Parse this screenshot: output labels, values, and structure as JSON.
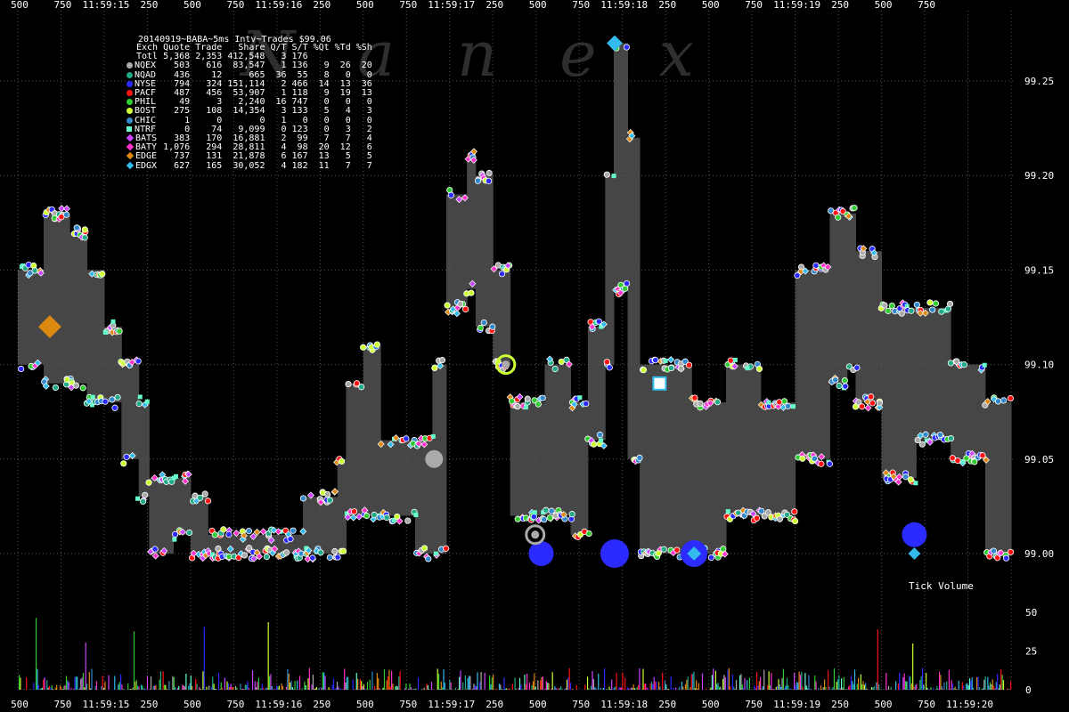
{
  "watermark": "Nanex",
  "title": "20140919~BABA~5ms Intv~Trades $99.06",
  "table": {
    "headers": [
      "Exch",
      "Quote",
      "Trade",
      "Share",
      "Q/T",
      "S/T",
      "%Qt",
      "%Td",
      "%Sh"
    ],
    "total": {
      "name": "Totl",
      "quote": "5,368",
      "trade": "2,353",
      "share": "412,548",
      "qt": "3",
      "st": "176",
      "pq": "",
      "pt": "",
      "ps": ""
    },
    "rows": [
      {
        "name": "NQEX",
        "quote": "503",
        "trade": "616",
        "share": "83,547",
        "qt": "1",
        "st": "136",
        "pq": "9",
        "pt": "26",
        "ps": "20",
        "color": "#aaaaaa",
        "shape": "dot"
      },
      {
        "name": "NQAD",
        "quote": "436",
        "trade": "12",
        "share": "665",
        "qt": "36",
        "st": "55",
        "pq": "8",
        "pt": "0",
        "ps": "0",
        "color": "#22aa88",
        "shape": "dot"
      },
      {
        "name": "NYSE",
        "quote": "794",
        "trade": "324",
        "share": "151,114",
        "qt": "2",
        "st": "466",
        "pq": "14",
        "pt": "13",
        "ps": "36",
        "color": "#2b2bff",
        "shape": "dot"
      },
      {
        "name": "PACF",
        "quote": "487",
        "trade": "456",
        "share": "53,907",
        "qt": "1",
        "st": "118",
        "pq": "9",
        "pt": "19",
        "ps": "13",
        "color": "#ff1111",
        "shape": "dot"
      },
      {
        "name": "PHIL",
        "quote": "49",
        "trade": "3",
        "share": "2,240",
        "qt": "16",
        "st": "747",
        "pq": "0",
        "pt": "0",
        "ps": "0",
        "color": "#33cc33",
        "shape": "dot"
      },
      {
        "name": "BOST",
        "quote": "275",
        "trade": "108",
        "share": "14,354",
        "qt": "3",
        "st": "133",
        "pq": "5",
        "pt": "4",
        "ps": "3",
        "color": "#ccff33",
        "shape": "dot"
      },
      {
        "name": "CHIC",
        "quote": "1",
        "trade": "0",
        "share": "0",
        "qt": "1",
        "st": "0",
        "pq": "0",
        "pt": "0",
        "ps": "0",
        "color": "#3388cc",
        "shape": "dot"
      },
      {
        "name": "NTRF",
        "quote": "0",
        "trade": "74",
        "share": "9,099",
        "qt": "0",
        "st": "123",
        "pq": "0",
        "pt": "3",
        "ps": "2",
        "color": "#66ffcc",
        "shape": "square"
      },
      {
        "name": "BATS",
        "quote": "383",
        "trade": "170",
        "share": "16,881",
        "qt": "2",
        "st": "99",
        "pq": "7",
        "pt": "7",
        "ps": "4",
        "color": "#cc44ff",
        "shape": "diamond"
      },
      {
        "name": "BATY",
        "quote": "1,076",
        "trade": "294",
        "share": "28,811",
        "qt": "4",
        "st": "98",
        "pq": "20",
        "pt": "12",
        "ps": "6",
        "color": "#ff33cc",
        "shape": "diamond"
      },
      {
        "name": "EDGE",
        "quote": "737",
        "trade": "131",
        "share": "21,878",
        "qt": "6",
        "st": "167",
        "pq": "13",
        "pt": "5",
        "ps": "5",
        "color": "#dd8811",
        "shape": "diamond"
      },
      {
        "name": "EDGX",
        "quote": "627",
        "trade": "165",
        "share": "30,052",
        "qt": "4",
        "st": "182",
        "pq": "11",
        "pt": "7",
        "ps": "7",
        "color": "#33bbee",
        "shape": "diamond"
      }
    ]
  },
  "tick_volume_label": "Tick Volume",
  "chart_data": {
    "type": "scatter",
    "xlabels": [
      "500",
      "750",
      "11:59:15",
      "250",
      "500",
      "750",
      "11:59:16",
      "250",
      "500",
      "750",
      "11:59:17",
      "250",
      "500",
      "750",
      "11:59:18",
      "250",
      "500",
      "750",
      "11:59:19",
      "250",
      "500",
      "750",
      "11:59:20"
    ],
    "xlabels_top": [
      "500",
      "750",
      "11:59:15",
      "250",
      "500",
      "750",
      "11:59:16",
      "250",
      "500",
      "750",
      "11:59:17",
      "250",
      "500",
      "750",
      "11:59:18",
      "250",
      "500",
      "750",
      "11:59:19",
      "250",
      "500",
      "750"
    ],
    "x_range_ms": [
      14500,
      20250
    ],
    "x_start_label": "11:59:14.500",
    "y_ticks": [
      "99.25",
      "99.20",
      "99.15",
      "99.10",
      "99.05",
      "99.00"
    ],
    "ylim": [
      98.99,
      99.28
    ],
    "volume_ticks": [
      "50",
      "25",
      "0"
    ],
    "volume_lim": [
      0,
      60
    ],
    "nbbo_spread": [
      [
        0,
        99.15,
        99.1
      ],
      [
        150,
        99.15,
        99.1
      ],
      [
        150,
        99.18,
        99.09
      ],
      [
        300,
        99.17,
        99.09
      ],
      [
        400,
        99.15,
        99.08
      ],
      [
        500,
        99.12,
        99.08
      ],
      [
        600,
        99.1,
        99.05
      ],
      [
        700,
        99.08,
        99.03
      ],
      [
        760,
        99.04,
        99.0
      ],
      [
        900,
        99.04,
        99.01
      ],
      [
        1000,
        99.03,
        99.0
      ],
      [
        1100,
        99.01,
        99.0
      ],
      [
        1500,
        99.01,
        99.0
      ],
      [
        1650,
        99.03,
        99.0
      ],
      [
        1850,
        99.05,
        99.0
      ],
      [
        1900,
        99.09,
        99.02
      ],
      [
        2000,
        99.11,
        99.02
      ],
      [
        2100,
        99.06,
        99.02
      ],
      [
        2300,
        99.06,
        99.0
      ],
      [
        2400,
        99.1,
        99.0
      ],
      [
        2480,
        99.19,
        99.13
      ],
      [
        2600,
        99.21,
        99.14
      ],
      [
        2650,
        99.2,
        99.12
      ],
      [
        2750,
        99.15,
        99.1
      ],
      [
        2850,
        99.08,
        99.02
      ],
      [
        3050,
        99.1,
        99.02
      ],
      [
        3200,
        99.08,
        99.01
      ],
      [
        3300,
        99.12,
        99.06
      ],
      [
        3400,
        99.2,
        99.1
      ],
      [
        3450,
        99.27,
        99.14
      ],
      [
        3530,
        99.22,
        99.05
      ],
      [
        3600,
        99.1,
        99.0
      ],
      [
        3900,
        99.08,
        99.0
      ],
      [
        4100,
        99.1,
        99.02
      ],
      [
        4300,
        99.08,
        99.02
      ],
      [
        4500,
        99.15,
        99.05
      ],
      [
        4700,
        99.18,
        99.09
      ],
      [
        4800,
        99.18,
        99.1
      ],
      [
        4850,
        99.16,
        99.08
      ],
      [
        5000,
        99.13,
        99.04
      ],
      [
        5200,
        99.13,
        99.06
      ],
      [
        5400,
        99.1,
        99.05
      ],
      [
        5600,
        99.08,
        99.0
      ],
      [
        5750,
        99.08,
        99.0
      ]
    ],
    "large_markers": [
      {
        "t": 185,
        "p": 99.12,
        "c": "#dd8811",
        "s": "diamond",
        "r": 13
      },
      {
        "t": 2825,
        "p": 99.1,
        "c": "#ccff33",
        "s": "ring",
        "r": 10
      },
      {
        "t": 3030,
        "p": 99.0,
        "c": "#2b2bff",
        "s": "dot",
        "r": 14
      },
      {
        "t": 3455,
        "p": 99.27,
        "c": "#33bbee",
        "s": "diamond",
        "r": 9
      },
      {
        "t": 3455,
        "p": 99.0,
        "c": "#2b2bff",
        "s": "dot",
        "r": 16
      },
      {
        "t": 3715,
        "p": 99.09,
        "c": "#ffffff",
        "s": "square",
        "r": 7
      },
      {
        "t": 3915,
        "p": 99.0,
        "c": "#2b2bff",
        "s": "dot",
        "r": 15
      },
      {
        "t": 3915,
        "p": 99.0,
        "c": "#33bbee",
        "s": "diamond",
        "r": 8
      },
      {
        "t": 5190,
        "p": 99.01,
        "c": "#2b2bff",
        "s": "dot",
        "r": 14
      },
      {
        "t": 5190,
        "p": 99.0,
        "c": "#33bbee",
        "s": "diamond",
        "r": 7
      },
      {
        "t": 2410,
        "p": 99.05,
        "c": "#aaaaaa",
        "s": "dot",
        "r": 10
      },
      {
        "t": 2995,
        "p": 99.01,
        "c": "#aaaaaa",
        "s": "ring",
        "r": 10
      }
    ]
  }
}
